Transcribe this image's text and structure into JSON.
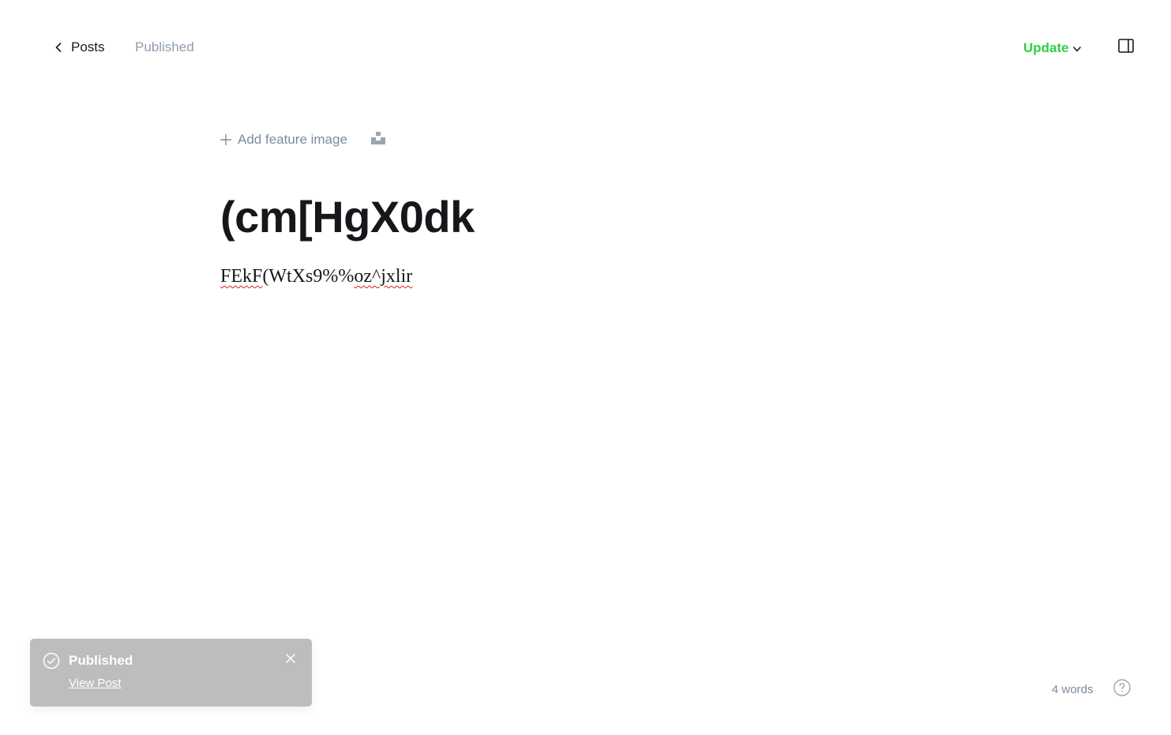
{
  "header": {
    "back_label": "Posts",
    "status": "Published",
    "update_label": "Update",
    "accent_color": "#30cf43"
  },
  "editor": {
    "add_feature_image_label": "Add feature image",
    "title": "(cm[HgX0dk",
    "body_segments": [
      {
        "text": "FEkF",
        "misspelled": true
      },
      {
        "text": "(WtXs9%%",
        "misspelled": false
      },
      {
        "text": "oz^jxlir",
        "misspelled": true
      }
    ]
  },
  "notification": {
    "title": "Published",
    "link_label": "View Post",
    "background": "#bdbdbd"
  },
  "footer": {
    "word_count": "4 words"
  },
  "icons": {
    "back": "chevron-left-icon",
    "update_caret": "chevron-down-icon",
    "sidebar": "sidebar-panel-icon",
    "add": "plus-icon",
    "unsplash": "unsplash-icon",
    "check": "check-circle-icon",
    "close": "close-icon",
    "help": "question-circle-icon"
  }
}
